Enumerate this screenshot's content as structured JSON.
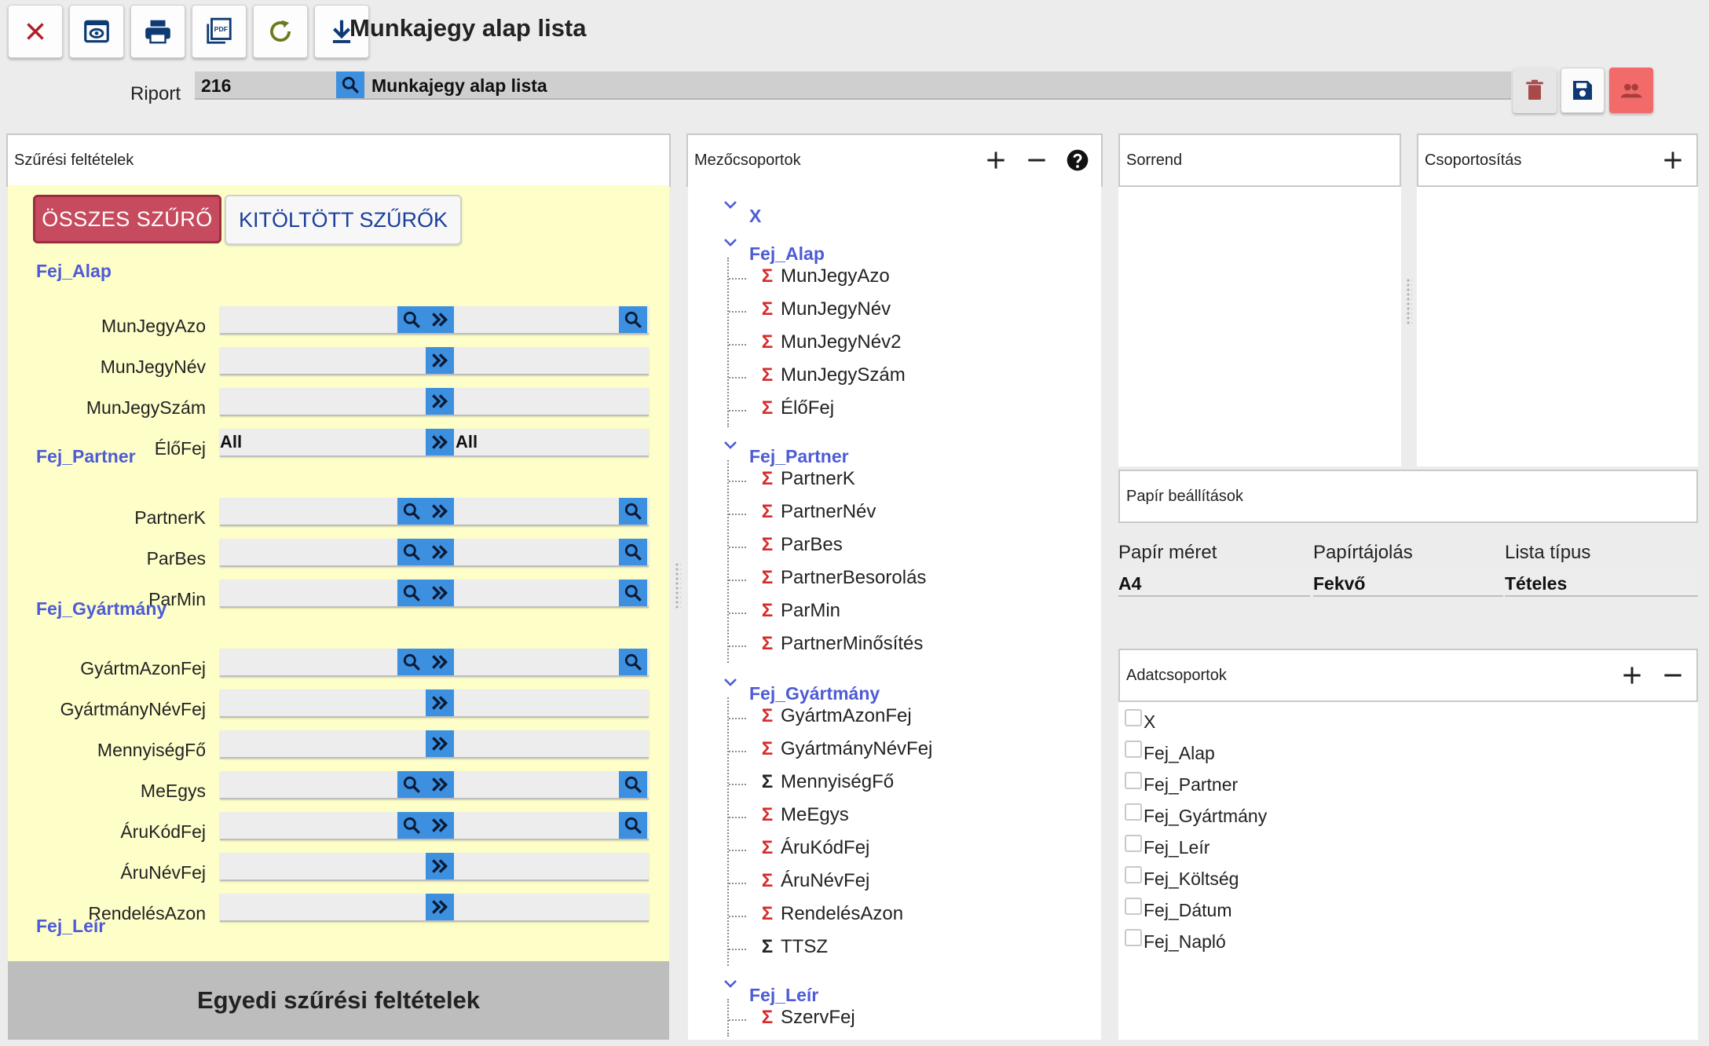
{
  "toolbar": {
    "title": "Munkajegy alap lista",
    "buttons": [
      "close-icon",
      "preview-icon",
      "print-icon",
      "pdf-icon",
      "refresh-icon",
      "download-icon"
    ]
  },
  "report": {
    "label": "Riport",
    "id": "216",
    "name": "Munkajegy alap lista"
  },
  "filters": {
    "header": "Szűrési feltételek",
    "btn_all": "ÖSSZES SZŰRŐ",
    "btn_filled": "KITÖLTÖTT SZŰRŐK",
    "groups": [
      {
        "name": "Fej_Alap"
      },
      {
        "name": "Fej_Partner"
      },
      {
        "name": "Fej_Gyártmány"
      },
      {
        "name": "Fej_Leír"
      }
    ],
    "rows": [
      {
        "label": "MunJegyAzo",
        "left": "",
        "right": ""
      },
      {
        "label": "MunJegyNév",
        "left": "",
        "right": ""
      },
      {
        "label": "MunJegySzám",
        "left": "",
        "right": ""
      },
      {
        "label": "ÉlőFej",
        "left": "All",
        "right": "All"
      },
      {
        "label": "PartnerK",
        "left": "",
        "right": ""
      },
      {
        "label": "ParBes",
        "left": "",
        "right": ""
      },
      {
        "label": "ParMin",
        "left": "",
        "right": ""
      },
      {
        "label": "GyártmAzonFej",
        "left": "",
        "right": ""
      },
      {
        "label": "GyártmányNévFej",
        "left": "",
        "right": ""
      },
      {
        "label": "MennyiségFő",
        "left": "",
        "right": ""
      },
      {
        "label": "MeEgys",
        "left": "",
        "right": ""
      },
      {
        "label": "ÁruKódFej",
        "left": "",
        "right": ""
      },
      {
        "label": "ÁruNévFej",
        "left": "",
        "right": ""
      },
      {
        "label": "RendelésAzon",
        "left": "",
        "right": ""
      },
      {
        "label": "SzervFej",
        "left": "",
        "right": ""
      }
    ],
    "custom": "Egyedi szűrési feltételek"
  },
  "fieldgroups": {
    "header": "Mezőcsoportok",
    "groups": [
      {
        "name": "X",
        "items": []
      },
      {
        "name": "Fej_Alap",
        "items": [
          {
            "label": "MunJegyAzo",
            "sym": "Σ"
          },
          {
            "label": "MunJegyNév",
            "sym": "Σ"
          },
          {
            "label": "MunJegyNév2",
            "sym": "Σ"
          },
          {
            "label": "MunJegySzám",
            "sym": "Σ"
          },
          {
            "label": "ÉlőFej",
            "sym": "Σ"
          }
        ]
      },
      {
        "name": "Fej_Partner",
        "items": [
          {
            "label": "PartnerK",
            "sym": "Σ"
          },
          {
            "label": "PartnerNév",
            "sym": "Σ"
          },
          {
            "label": "ParBes",
            "sym": "Σ"
          },
          {
            "label": "PartnerBesorolás",
            "sym": "Σ"
          },
          {
            "label": "ParMin",
            "sym": "Σ"
          },
          {
            "label": "PartnerMinősítés",
            "sym": "Σ"
          }
        ]
      },
      {
        "name": "Fej_Gyártmány",
        "items": [
          {
            "label": "GyártmAzonFej",
            "sym": "Σ"
          },
          {
            "label": "GyártmányNévFej",
            "sym": "Σ"
          },
          {
            "label": "MennyiségFő",
            "sym": "Σ"
          },
          {
            "label": "MeEgys",
            "sym": "Σ"
          },
          {
            "label": "ÁruKódFej",
            "sym": "Σ"
          },
          {
            "label": "ÁruNévFej",
            "sym": "Σ"
          },
          {
            "label": "RendelésAzon",
            "sym": "Σ"
          },
          {
            "label": "TTSZ",
            "sym": "Σ"
          }
        ]
      },
      {
        "name": "Fej_Leír",
        "items": [
          {
            "label": "SzervFej",
            "sym": "Σ"
          }
        ]
      }
    ]
  },
  "sort": {
    "header": "Sorrend"
  },
  "grouping": {
    "header": "Csoportosítás"
  },
  "paper": {
    "header": "Papír beállítások",
    "size_label": "Papír méret",
    "size_value": "A4",
    "orient_label": "Papírtájolás",
    "orient_value": "Fekvő",
    "type_label": "Lista típus",
    "type_value": "Tételes"
  },
  "datagroups": {
    "header": "Adatcsoportok",
    "items": [
      "X",
      "Fej_Alap",
      "Fej_Partner",
      "Fej_Gyártmány",
      "Fej_Leír",
      "Fej_Költség",
      "Fej_Dátum",
      "Fej_Napló"
    ]
  },
  "colors": {
    "accent_blue": "#3d8fe0",
    "group_label": "#4d5bd6",
    "filter_bg": "#fefec9",
    "all_btn": "#c74b5e",
    "sigma_red": "#d62b2b"
  }
}
